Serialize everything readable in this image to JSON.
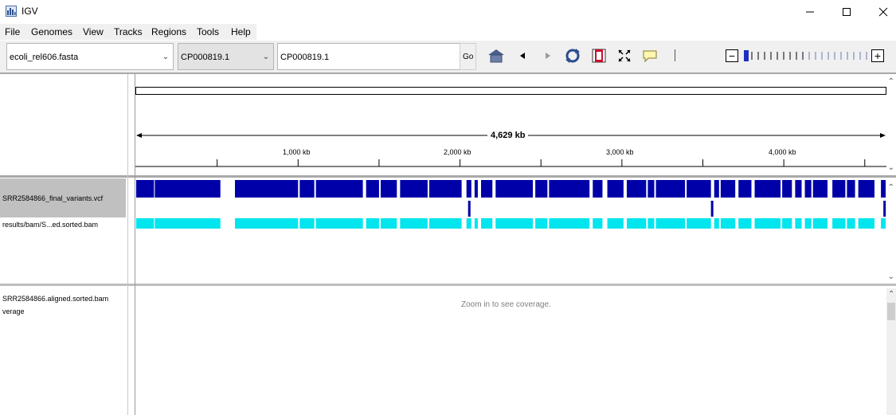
{
  "window": {
    "title": "IGV",
    "min_symbol": "—",
    "max_symbol": "☐",
    "close_symbol": "✕"
  },
  "menu": [
    "File",
    "Genomes",
    "View",
    "Tracks",
    "Regions",
    "Tools",
    "Help"
  ],
  "toolbar": {
    "genome": "ecoli_rel606.fasta",
    "chromosome": "CP000819.1",
    "locus": "CP000819.1",
    "go_label": "Go",
    "zoom_minus": "−",
    "zoom_plus": "+",
    "zoom_level": 0,
    "zoom_ticks": 20
  },
  "ruler": {
    "span_label": "4,629 kb",
    "ticks": [
      "1,000 kb",
      "2,000 kb",
      "3,000 kb",
      "4,000 kb"
    ],
    "genome_length_kb": 4629
  },
  "tracks": {
    "vcf_name": "SRR2584866_final_variants.vcf",
    "bam_name": "results/bam/S...ed.sorted.bam",
    "coverage_name_line1": "SRR2584866.aligned.sorted.bam",
    "coverage_name_line2": "verage",
    "coverage_message": "Zoom in to see coverage."
  },
  "colors": {
    "variant_blue": "#0000a8",
    "coverage_cyan": "#00e5ee",
    "sidebar_selected": "#c0c0c0"
  },
  "variant_blocks_kb": [
    [
      0,
      110
    ],
    [
      115,
      520
    ],
    [
      610,
      1000
    ],
    [
      1010,
      1100
    ],
    [
      1110,
      1400
    ],
    [
      1420,
      1500
    ],
    [
      1510,
      1610
    ],
    [
      1630,
      1800
    ],
    [
      1810,
      2010
    ],
    [
      2040,
      2070
    ],
    [
      2090,
      2110
    ],
    [
      2130,
      2200
    ],
    [
      2220,
      2450
    ],
    [
      2465,
      2540
    ],
    [
      2550,
      2800
    ],
    [
      2820,
      2880
    ],
    [
      2910,
      3010
    ],
    [
      3030,
      3150
    ],
    [
      3160,
      3200
    ],
    [
      3210,
      3390
    ],
    [
      3400,
      3550
    ],
    [
      3570,
      3600
    ],
    [
      3610,
      3700
    ],
    [
      3720,
      3800
    ],
    [
      3820,
      3980
    ],
    [
      3990,
      4050
    ],
    [
      4070,
      4110
    ],
    [
      4130,
      4170
    ],
    [
      4180,
      4270
    ],
    [
      4300,
      4380
    ],
    [
      4390,
      4440
    ],
    [
      4460,
      4560
    ],
    [
      4600,
      4629
    ]
  ],
  "variant_markers_kb": [
    2050,
    3550,
    4615
  ]
}
